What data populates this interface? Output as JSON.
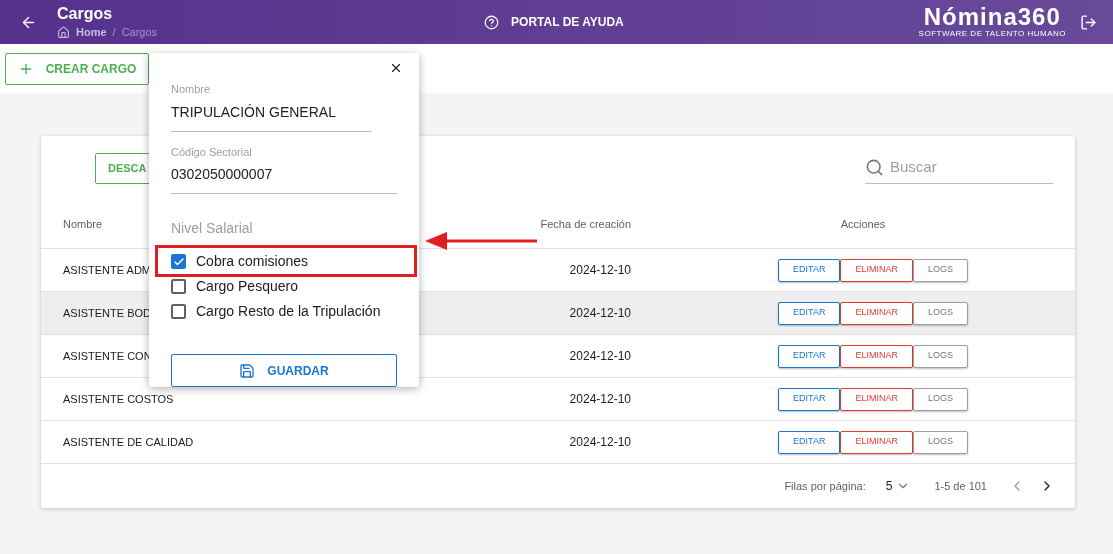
{
  "header": {
    "title": "Cargos",
    "breadcrumb": [
      "Home",
      "/",
      "Cargos"
    ],
    "help": "PORTAL DE AYUDA",
    "logo": "Nómina360",
    "logo_tagline": "SOFTWARE DE TALENTO HUMANO"
  },
  "create_button": "CREAR CARGO",
  "table": {
    "download_button": "DESCA",
    "search": {
      "placeholder": "Buscar"
    },
    "columns": [
      "Nombre",
      "Fecha de creación",
      "Acciones"
    ],
    "rows": [
      {
        "name": "ASISTENTE ADM",
        "date": "2024-12-10",
        "selected": false,
        "actions": [
          "EDITAR",
          "ELIMINAR",
          "LOGS"
        ]
      },
      {
        "name": "ASISTENTE BOD",
        "date": "2024-12-10",
        "selected": true,
        "actions": [
          "EDITAR",
          "ELIMINAR",
          "LOGS"
        ]
      },
      {
        "name": "ASISTENTE CON",
        "date": "2024-12-10",
        "selected": false,
        "actions": [
          "EDITAR",
          "ELIMINAR",
          "LOGS"
        ]
      },
      {
        "name": "ASISTENTE COSTOS",
        "date": "2024-12-10",
        "selected": false,
        "actions": [
          "EDITAR",
          "ELIMINAR",
          "LOGS"
        ]
      },
      {
        "name": "ASISTENTE DE CALIDAD",
        "date": "2024-12-10",
        "selected": false,
        "actions": [
          "EDITAR",
          "ELIMINAR",
          "LOGS"
        ]
      }
    ],
    "footer": {
      "rows_label": "Filas por página:",
      "rows_value": "5",
      "range": "1-5 de 101"
    }
  },
  "dialog": {
    "fields": [
      {
        "label": "Nombre",
        "value": "TRIPULACIÓN GENERAL"
      },
      {
        "label": "Código Sectorial",
        "value": "0302050000007"
      }
    ],
    "section": "Nivel Salarial",
    "options": [
      {
        "label": "Cobra comisiones",
        "checked": true,
        "highlighted": true
      },
      {
        "label": "Cargo Pesquero",
        "checked": false,
        "highlighted": false
      },
      {
        "label": "Cargo Resto de la Tripulación",
        "checked": false,
        "highlighted": false
      }
    ],
    "save_button": "GUARDAR"
  }
}
